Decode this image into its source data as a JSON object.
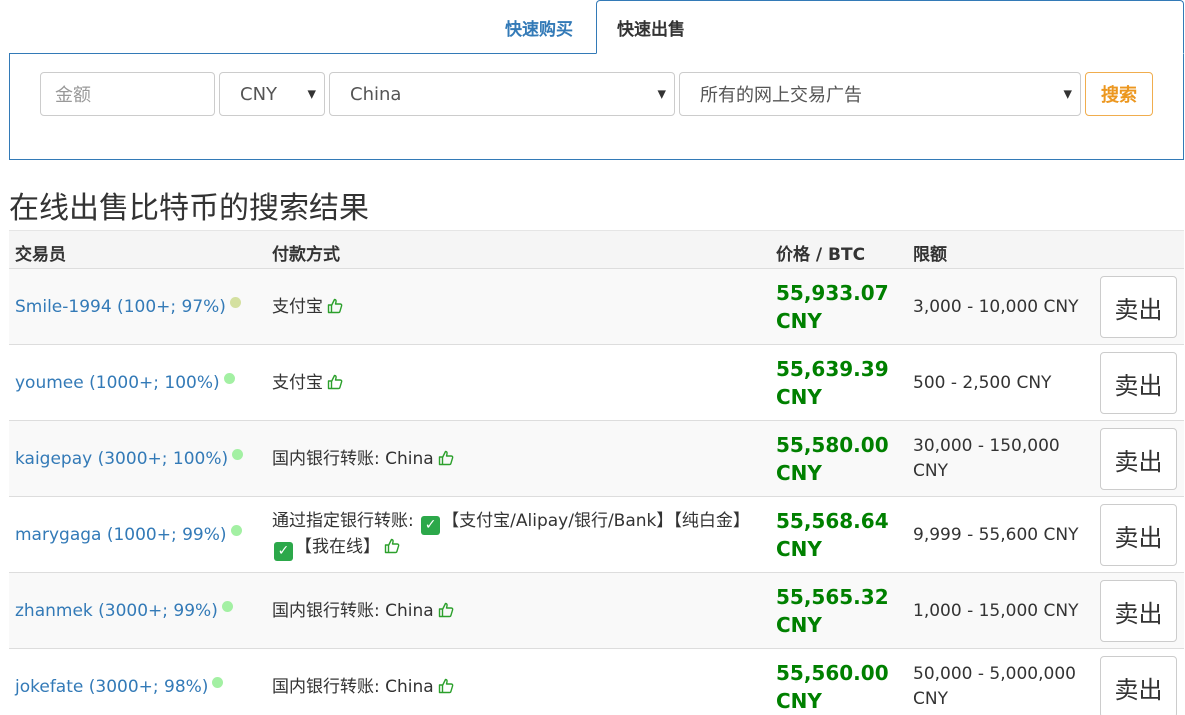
{
  "tabs": [
    {
      "label": "快速购买",
      "active": false
    },
    {
      "label": "快速出售",
      "active": true
    }
  ],
  "search": {
    "amount_placeholder": "金额",
    "currency": "CNY",
    "country": "China",
    "ad_type": "所有的网上交易广告",
    "button": "搜索"
  },
  "heading": "在线出售比特币的搜索结果",
  "table": {
    "headers": {
      "trader": "交易员",
      "payment": "付款方式",
      "price": "价格 / BTC",
      "limit": "限额"
    },
    "rows": [
      {
        "trader": "Smile-1994 (100+; 97%)",
        "status_color": "#d4e0a0",
        "payment": "支付宝",
        "payment_extra": "",
        "price": "55,933.07",
        "currency": "CNY",
        "limit": "3,000 - 10,000 CNY",
        "action": "卖出"
      },
      {
        "trader": "youmee (1000+; 100%)",
        "status_color": "#a3f0a3",
        "payment": "支付宝",
        "payment_extra": "",
        "price": "55,639.39",
        "currency": "CNY",
        "limit": "500 - 2,500 CNY",
        "action": "卖出"
      },
      {
        "trader": "kaigepay (3000+; 100%)",
        "status_color": "#a3f0a3",
        "payment": "国内银行转账: China",
        "payment_extra": "",
        "price": "55,580.00",
        "currency": "CNY",
        "limit": "30,000 - 150,000 CNY",
        "action": "卖出"
      },
      {
        "trader": "marygaga (1000+; 99%)",
        "status_color": "#a3f0a3",
        "payment": "通过指定银行转账:",
        "payment_extra": "【支付宝/Alipay/银行/Bank】【纯白金】",
        "payment_extra2": "【我在线】",
        "price": "55,568.64",
        "currency": "CNY",
        "limit": "9,999 - 55,600 CNY",
        "action": "卖出"
      },
      {
        "trader": "zhanmek (3000+; 99%)",
        "status_color": "#a3f0a3",
        "payment": "国内银行转账: China",
        "payment_extra": "",
        "price": "55,565.32",
        "currency": "CNY",
        "limit": "1,000 - 15,000 CNY",
        "action": "卖出"
      },
      {
        "trader": "jokefate (3000+; 98%)",
        "status_color": "#a3f0a3",
        "payment": "国内银行转账: China",
        "payment_extra": "",
        "price": "55,560.00",
        "currency": "CNY",
        "limit": "50,000 - 5,000,000 CNY",
        "action": "卖出"
      }
    ]
  },
  "icons": {
    "thumbs_up": "thumbs-up-icon",
    "check": "check-mark-icon",
    "caret": "caret-down-icon"
  },
  "colors": {
    "link": "#337ab7",
    "price": "#008000",
    "search_button": "#ec971f"
  }
}
